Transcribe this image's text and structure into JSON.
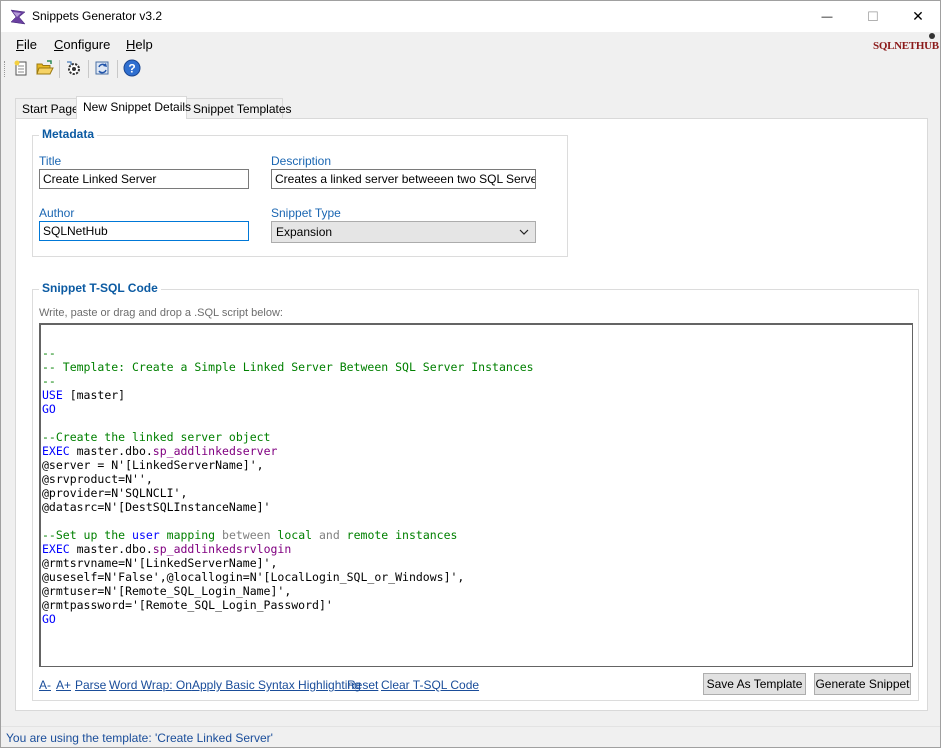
{
  "window": {
    "title": "Snippets Generator v3.2",
    "controls": {
      "minimize": "—",
      "maximize": "☐",
      "close": "✕"
    }
  },
  "menu": {
    "file": {
      "accel": "F",
      "rest": "ile"
    },
    "configure": {
      "accel": "C",
      "rest": "onfigure"
    },
    "help": {
      "accel": "H",
      "rest": "elp"
    }
  },
  "brand": {
    "logo_text": "SQLNETHUB"
  },
  "toolbar": {
    "icons": [
      "new-file-icon",
      "open-folder-icon",
      "settings-icon",
      "refresh-icon",
      "help-icon"
    ]
  },
  "tabs": [
    {
      "label": "Start Page"
    },
    {
      "label": "New Snippet Details"
    },
    {
      "label": "Snippet Templates"
    }
  ],
  "metadata": {
    "group_title": "Metadata",
    "title_label": "Title",
    "title_value": "Create Linked Server",
    "description_label": "Description",
    "description_value": "Creates a linked server betweeen two SQL Server insta",
    "author_label": "Author",
    "author_value": "SQLNetHub",
    "snippet_type_label": "Snippet Type",
    "snippet_type_value": "Expansion"
  },
  "code_section": {
    "group_title": "Snippet  T-SQL Code",
    "hint": "Write, paste or drag and drop a .SQL script below:"
  },
  "code_lines": [
    "",
    "--",
    "-- Template: Create a Simple Linked Server Between SQL Server Instances",
    "--",
    "USE [master]",
    "GO",
    "",
    "--Create the linked server object",
    "EXEC master.dbo.sp_addlinkedserver",
    "@server = N'[LinkedServerName]',",
    "@srvproduct=N'',",
    "@provider=N'SQLNCLI',",
    "@datasrc=N'[DestSQLInstanceName]'",
    "",
    "--Set up the user mapping between local and remote instances",
    "EXEC master.dbo.sp_addlinkedsrvlogin",
    "@rmtsrvname=N'[LinkedServerName]',",
    "@useself=N'False',@locallogin=N'[LocalLogin_SQL_or_Windows]',",
    "@rmtuser=N'[Remote_SQL_Login_Name]',",
    "@rmtpassword='[Remote_SQL_Login_Password]'",
    "GO"
  ],
  "actions": {
    "font_decrease": "A-",
    "font_increase": "A+",
    "parse": "Parse",
    "word_wrap": "Word Wrap: On",
    "syntax_highlight": "Apply Basic Syntax Highlighting",
    "reset": "Reset",
    "clear": "Clear T-SQL Code",
    "save_template": "Save As Template",
    "generate": "Generate Snippet"
  },
  "status": {
    "text": "You are using the template: 'Create Linked Server'"
  },
  "colors": {
    "accent": "#0b5aa2",
    "link": "#1a4d9a",
    "keyword": "#0000ff",
    "comment": "#008000",
    "procedure": "#800080"
  }
}
